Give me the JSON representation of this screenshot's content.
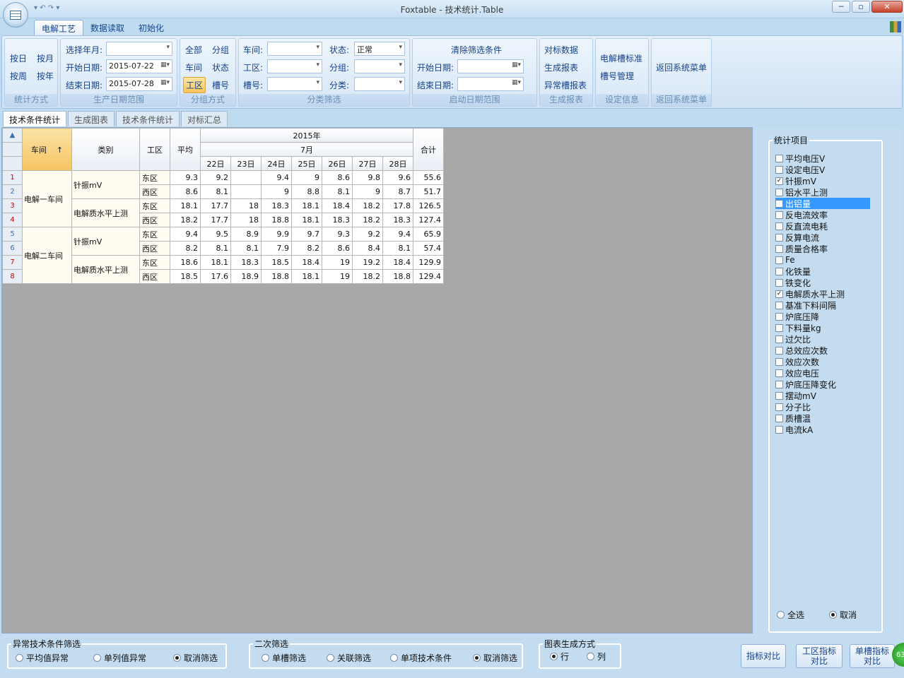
{
  "window": {
    "title": "Foxtable - 技术统计.Table",
    "qat": "▾ ↶ ↷ ▾"
  },
  "ribbon_tabs": [
    "电解工艺",
    "数据读取",
    "初始化"
  ],
  "ribbon": {
    "stat": {
      "title": "统计方式",
      "b1": "按日",
      "b2": "按月",
      "b3": "按周",
      "b4": "按年"
    },
    "prod": {
      "title": "生产日期范围",
      "l1": "选择年月:",
      "l2": "开始日期:",
      "l3": "结束日期:",
      "v1": "",
      "v2": "2015-07-22",
      "v3": "2015-07-28"
    },
    "grp": {
      "title": "分组方式",
      "b1": "全部",
      "b2": "分组",
      "b3": "车间",
      "b4": "状态",
      "b5": "工区",
      "b6": "槽号"
    },
    "cls": {
      "title": "分类筛选",
      "l1": "车间:",
      "l2": "工区:",
      "l3": "槽号:",
      "l4": "状态:",
      "l5": "分组:",
      "l6": "分类:",
      "v4": "正常"
    },
    "start": {
      "title": "启动日期范围",
      "clear": "清除筛选条件",
      "l1": "开始日期:",
      "l2": "结束日期:"
    },
    "report": {
      "title": "生成报表",
      "b1": "对标数据",
      "b2": "生成报表",
      "b3": "异常槽报表"
    },
    "setting": {
      "title": "设定信息",
      "b1": "电解槽标准",
      "b2": "槽号管理"
    },
    "back": {
      "title": "返回系统菜单",
      "b1": "返回系统菜单"
    }
  },
  "doc_tabs": [
    "技术条件统计",
    "生成图表",
    "技术条件统计",
    "对标汇总"
  ],
  "grid": {
    "h_workshop": "车间",
    "h_sort": "↑",
    "h_type": "类别",
    "h_area": "工区",
    "h_avg": "平均",
    "h_year": "2015年",
    "h_month": "7月",
    "h_total": "合计",
    "days": [
      "22日",
      "23日",
      "24日",
      "25日",
      "26日",
      "27日",
      "28日"
    ],
    "workshops": [
      "电解一车间",
      "电解二车间"
    ],
    "types": [
      "针振mV",
      "电解质水平上测",
      "针振mV",
      "电解质水平上测"
    ],
    "rows": [
      {
        "n": "1",
        "area": "东区",
        "avg": "9.3",
        "d": [
          "9.2",
          "",
          "9.4",
          "9",
          "8.6",
          "9.8",
          "9.6"
        ],
        "total": "55.6"
      },
      {
        "n": "2",
        "area": "西区",
        "avg": "8.6",
        "d": [
          "8.1",
          "",
          "9",
          "8.8",
          "8.1",
          "9",
          "8.7"
        ],
        "total": "51.7"
      },
      {
        "n": "3",
        "area": "东区",
        "avg": "18.1",
        "d": [
          "17.7",
          "18",
          "18.3",
          "18.1",
          "18.4",
          "18.2",
          "17.8"
        ],
        "total": "126.5"
      },
      {
        "n": "4",
        "area": "西区",
        "avg": "18.2",
        "d": [
          "17.7",
          "18",
          "18.8",
          "18.1",
          "18.3",
          "18.2",
          "18.3"
        ],
        "total": "127.4"
      },
      {
        "n": "5",
        "area": "东区",
        "avg": "9.4",
        "d": [
          "9.5",
          "8.9",
          "9.9",
          "9.7",
          "9.3",
          "9.2",
          "9.4"
        ],
        "total": "65.9"
      },
      {
        "n": "6",
        "area": "西区",
        "avg": "8.2",
        "d": [
          "8.1",
          "8.1",
          "7.9",
          "8.2",
          "8.6",
          "8.4",
          "8.1"
        ],
        "total": "57.4"
      },
      {
        "n": "7",
        "area": "东区",
        "avg": "18.6",
        "d": [
          "18.1",
          "18.3",
          "18.5",
          "18.4",
          "19",
          "19.2",
          "18.4"
        ],
        "total": "129.9"
      },
      {
        "n": "8",
        "area": "西区",
        "avg": "18.5",
        "d": [
          "17.6",
          "18.9",
          "18.8",
          "18.1",
          "19",
          "18.2",
          "18.8"
        ],
        "total": "129.4"
      }
    ]
  },
  "side": {
    "title": "统计项目",
    "all": "全选",
    "cancel": "取消",
    "items": [
      {
        "label": "平均电压V",
        "checked": false
      },
      {
        "label": "设定电压V",
        "checked": false
      },
      {
        "label": "针振mV",
        "checked": true
      },
      {
        "label": "铝水平上测",
        "checked": false
      },
      {
        "label": "出铝量",
        "checked": false
      },
      {
        "label": "反电流效率",
        "checked": false
      },
      {
        "label": "反直流电耗",
        "checked": false
      },
      {
        "label": "反算电流",
        "checked": false
      },
      {
        "label": "质量合格率",
        "checked": false
      },
      {
        "label": "Fe",
        "checked": false
      },
      {
        "label": "化铁量",
        "checked": false
      },
      {
        "label": "铁变化",
        "checked": false
      },
      {
        "label": "电解质水平上测",
        "checked": true
      },
      {
        "label": "基准下料间隔",
        "checked": false
      },
      {
        "label": "炉底压降",
        "checked": false
      },
      {
        "label": "下料量kg",
        "checked": false
      },
      {
        "label": "过欠比",
        "checked": false
      },
      {
        "label": "总效应次数",
        "checked": false
      },
      {
        "label": "效应次数",
        "checked": false
      },
      {
        "label": "效应电压",
        "checked": false
      },
      {
        "label": "炉底压降变化",
        "checked": false
      },
      {
        "label": "摆动mV",
        "checked": false
      },
      {
        "label": "分子比",
        "checked": false
      },
      {
        "label": "质槽温",
        "checked": false
      },
      {
        "label": "电流kA",
        "checked": false
      }
    ]
  },
  "bottom": {
    "g1": {
      "title": "异常技术条件筛选",
      "r": [
        "平均值异常",
        "单列值异常",
        "取消筛选"
      ]
    },
    "g2": {
      "title": "二次筛选",
      "r": [
        "单槽筛选",
        "关联筛选",
        "单项技术条件",
        "取消筛选"
      ]
    },
    "g3": {
      "title": "图表生成方式",
      "r": [
        "行",
        "列"
      ]
    },
    "b1": "指标对比",
    "b2a": "工区指标",
    "b2b": "对比",
    "b3a": "单槽指标",
    "b3b": "对比",
    "corner": "63"
  }
}
